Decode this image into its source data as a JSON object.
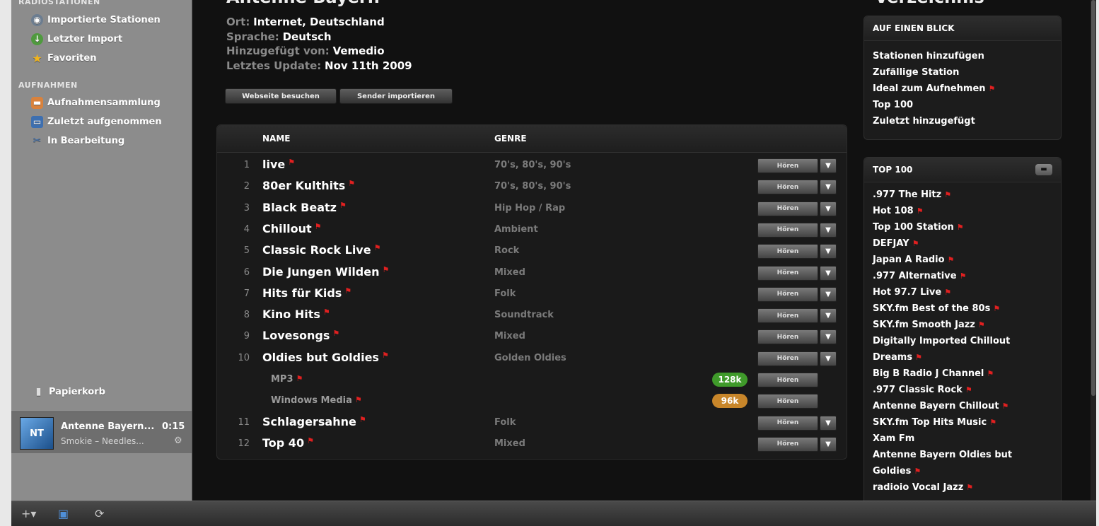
{
  "sidebar": {
    "section_radio": "RADIOSTATIONEN",
    "radio_items": [
      {
        "label": "Importierte Stationen",
        "icon": "globe-icon"
      },
      {
        "label": "Letzter Import",
        "icon": "download-icon"
      },
      {
        "label": "Favoriten",
        "icon": "star-icon"
      }
    ],
    "section_recordings": "AUFNAHMEN",
    "recording_items": [
      {
        "label": "Aufnahmensammlung",
        "icon": "box-icon"
      },
      {
        "label": "Zuletzt aufgenommen",
        "icon": "tray-icon"
      },
      {
        "label": "In Bearbeitung",
        "icon": "scissors-icon"
      }
    ],
    "trash_label": "Papierkorb",
    "now_playing": {
      "art_text": "NT",
      "title": "Antenne Bayern...",
      "time": "0:15",
      "subtitle": "Smokie – Needles..."
    }
  },
  "station": {
    "title": "Antenne Bayern",
    "ort_key": "Ort:",
    "ort_value": "Internet, Deutschland",
    "sprache_key": "Sprache:",
    "sprache_value": "Deutsch",
    "added_key": "Hinzugefügt von:",
    "added_value": "Vemedio",
    "update_key": "Letztes Update:",
    "update_value": "Nov 11th 2009",
    "visit_btn": "Webseite besuchen",
    "import_btn": "Sender importieren"
  },
  "table": {
    "col_name": "NAME",
    "col_genre": "GENRE",
    "listen_label": "Hören",
    "rows": [
      {
        "num": "1",
        "name": "live",
        "genre": "70's, 80's, 90's"
      },
      {
        "num": "2",
        "name": "80er Kulthits",
        "genre": "70's, 80's, 90's"
      },
      {
        "num": "3",
        "name": "Black Beatz",
        "genre": "Hip Hop / Rap"
      },
      {
        "num": "4",
        "name": "Chillout",
        "genre": "Ambient"
      },
      {
        "num": "5",
        "name": "Classic Rock Live",
        "genre": "Rock"
      },
      {
        "num": "6",
        "name": "Die Jungen Wilden",
        "genre": "Mixed"
      },
      {
        "num": "7",
        "name": "Hits für Kids",
        "genre": "Folk"
      },
      {
        "num": "8",
        "name": "Kino Hits",
        "genre": "Soundtrack"
      },
      {
        "num": "9",
        "name": "Lovesongs",
        "genre": "Mixed"
      },
      {
        "num": "10",
        "name": "Oldies but Goldies",
        "genre": "Golden Oldies"
      },
      {
        "num": "11",
        "name": "Schlagersahne",
        "genre": "Folk"
      },
      {
        "num": "12",
        "name": "Top 40",
        "genre": "Mixed"
      }
    ],
    "streams": [
      {
        "name": "MP3",
        "bitrate": "128k",
        "color": "#3f9a2a"
      },
      {
        "name": "Windows Media",
        "bitrate": "96k",
        "color": "#c8862a"
      }
    ]
  },
  "right": {
    "title": "Verzeichnis",
    "glance_title": "AUF EINEN BLICK",
    "glance_items": [
      "Stationen hinzufügen",
      "Zufällige Station",
      "Ideal zum Aufnehmen",
      "Top 100",
      "Zuletzt hinzugefügt"
    ],
    "top_title": "TOP 100",
    "top_items": [
      ".977 The Hitz",
      "Hot 108",
      "Top 100 Station",
      "DEFJAY",
      "Japan A Radio",
      ".977 Alternative",
      "Hot 97.7 Live",
      "SKY.fm Best of the 80s",
      "SKY.fm Smooth Jazz",
      "Digitally Imported Chillout",
      "Dreams",
      "Big B Radio J Channel",
      ".977 Classic Rock",
      "Antenne Bayern Chillout",
      "SKY.fm Top Hits Music",
      "Xam Fm",
      "Antenne Bayern Oldies but",
      "Goldies",
      "radioio Vocal Jazz"
    ]
  },
  "colors": {
    "flag": "#e02020",
    "background": "#111111",
    "sidebar": "#8c8c8c"
  }
}
